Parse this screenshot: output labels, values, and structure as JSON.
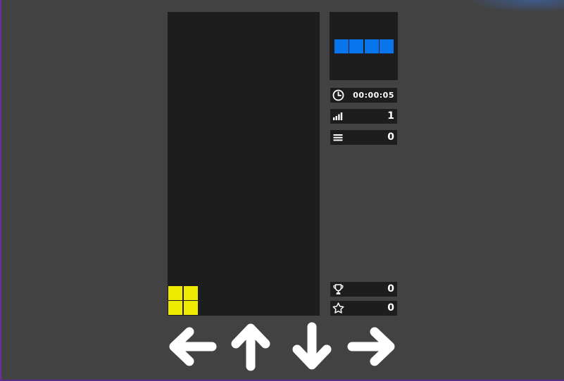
{
  "colors": {
    "background": "#424242",
    "board": "#1d1d1d",
    "o_piece": "#eeea00",
    "i_piece": "#0a76ee",
    "text": "#ffffff"
  },
  "board": {
    "columns": 10,
    "rows": 20,
    "active_piece": {
      "type": "O",
      "color": "#eeea00",
      "cells": [
        [
          0,
          18
        ],
        [
          1,
          18
        ],
        [
          0,
          19
        ],
        [
          1,
          19
        ]
      ]
    }
  },
  "next_piece": {
    "type": "I",
    "color": "#0a76ee",
    "cells": 4
  },
  "stats": {
    "time": {
      "icon": "clock-icon",
      "value": "00:00:05"
    },
    "level": {
      "icon": "signal-bars-icon",
      "value": "1"
    },
    "lines": {
      "icon": "lines-icon",
      "value": "0"
    },
    "high_score": {
      "icon": "trophy-icon",
      "value": "0"
    },
    "score": {
      "icon": "star-icon",
      "value": "0"
    }
  },
  "controls": [
    {
      "name": "left-arrow-button",
      "icon": "arrow-left-icon"
    },
    {
      "name": "rotate-up-arrow-button",
      "icon": "arrow-up-icon"
    },
    {
      "name": "down-arrow-button",
      "icon": "arrow-down-icon"
    },
    {
      "name": "right-arrow-button",
      "icon": "arrow-right-icon"
    }
  ]
}
